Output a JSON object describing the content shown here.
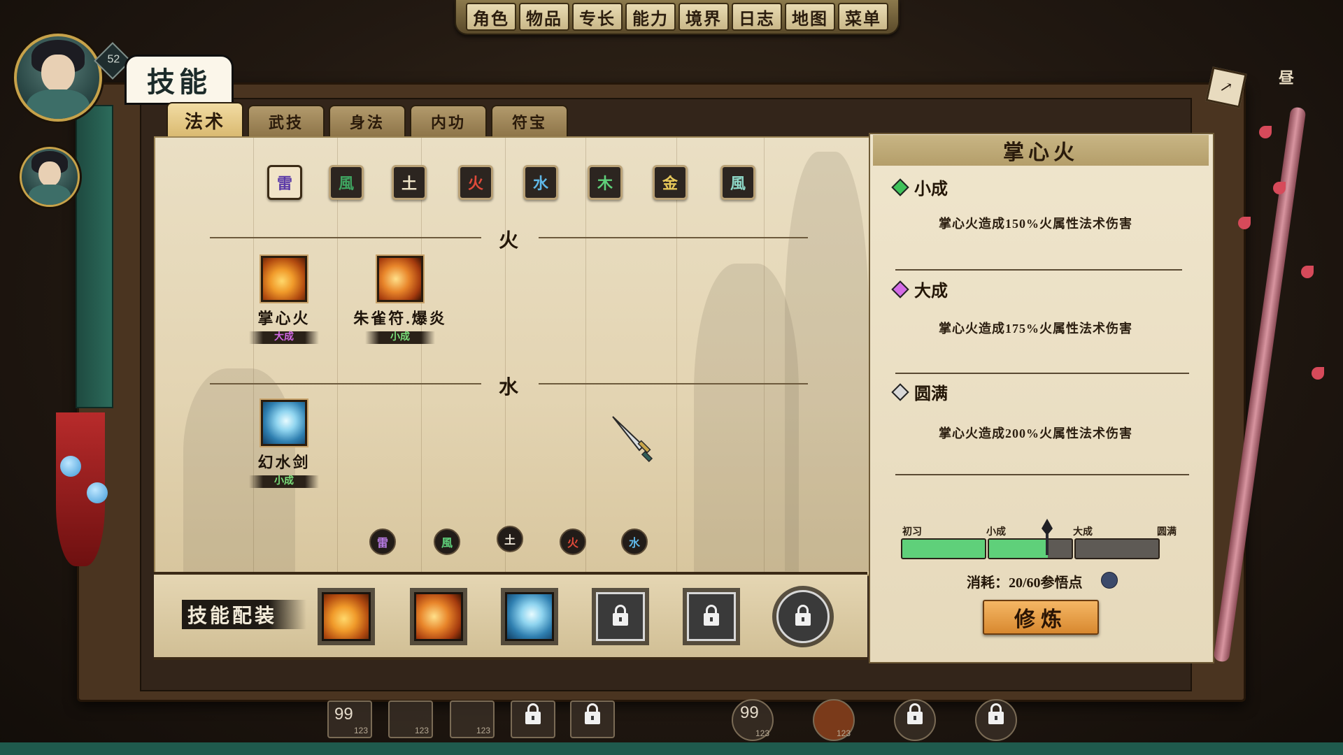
{
  "top_menu": [
    "角色",
    "物品",
    "专长",
    "能力",
    "境界",
    "日志",
    "地图",
    "菜单"
  ],
  "player": {
    "level": "52",
    "realm_hint": "境界"
  },
  "right_corner_labels": [
    "昼"
  ],
  "page_title": "技能",
  "tabs": [
    "法术",
    "武技",
    "身法",
    "内功",
    "符宝"
  ],
  "element_filters": [
    "雷",
    "風",
    "土",
    "火",
    "水",
    "木",
    "金",
    "風"
  ],
  "element_filters_bottom": [
    "雷",
    "風",
    "土",
    "火",
    "水"
  ],
  "sections": [
    {
      "label": "火",
      "skills": [
        {
          "name": "掌心火",
          "rank": "大成",
          "rank_color": "#d268e4"
        },
        {
          "name": "朱雀符.爆炎",
          "rank": "小成",
          "rank_color": "#7be07b"
        }
      ]
    },
    {
      "label": "水",
      "skills": [
        {
          "name": "幻水剑",
          "rank": "小成",
          "rank_color": "#7be07b"
        }
      ]
    }
  ],
  "equip": {
    "title": "技能配装",
    "slots": [
      "掌心火",
      "朱雀符.爆炎",
      "幻水剑",
      "locked",
      "locked",
      "locked"
    ]
  },
  "detail": {
    "skill_name": "掌心火",
    "tiers": [
      {
        "name": "小成",
        "color": "#3fc25a",
        "desc": "掌心火造成150%火属性法术伤害"
      },
      {
        "name": "大成",
        "color": "#d36be6",
        "desc": "掌心火造成175%火属性法术伤害"
      },
      {
        "name": "圆满",
        "color": "#d8d8d8",
        "desc": "掌心火造成200%火属性法术伤害"
      }
    ],
    "progress_labels": [
      "初习",
      "小成",
      "大成",
      "圆满"
    ],
    "progress_fraction": 0.57,
    "cost_text": "消耗：20/60参悟点",
    "train_label": "修炼"
  },
  "hotbar": [
    {
      "count": "99",
      "sub": "123"
    },
    {
      "count": "",
      "sub": "123"
    },
    {
      "count": "",
      "sub": "123"
    },
    {
      "count": "",
      "sub": ""
    },
    {
      "count": "",
      "sub": ""
    },
    {
      "count": "99",
      "sub": "123"
    },
    {
      "count": "",
      "sub": "123"
    }
  ],
  "colors": {
    "green_progress": "#5fd07a",
    "parchment": "#eadfc4",
    "accent_orange": "#e6a04a"
  }
}
